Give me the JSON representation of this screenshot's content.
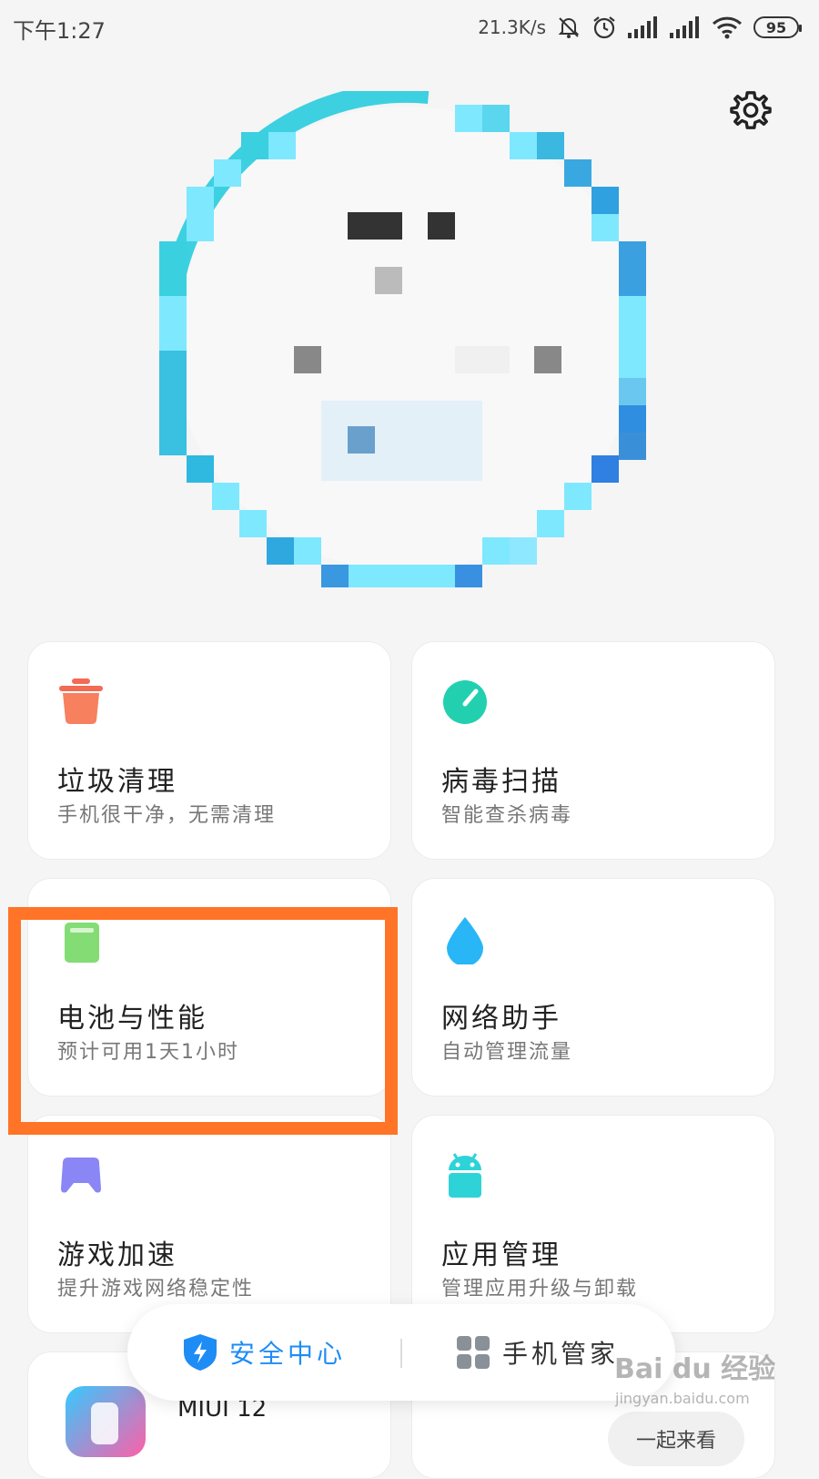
{
  "status_bar": {
    "time": "下午1:27",
    "net_speed": "21.3K/s",
    "battery": "95",
    "icons": [
      "mute-bell-icon",
      "alarm-icon",
      "signal-icon",
      "signal-icon",
      "wifi-icon",
      "battery-icon"
    ]
  },
  "header": {
    "settings_icon": "gear-icon"
  },
  "cards": [
    {
      "title": "垃圾清理",
      "subtitle": "手机很干净，无需清理",
      "icon": "trash-icon",
      "color": "#f36a55"
    },
    {
      "title": "病毒扫描",
      "subtitle": "智能查杀病毒",
      "icon": "scan-gauge-icon",
      "color": "#22d0b0"
    },
    {
      "title": "电池与性能",
      "subtitle": "预计可用1天1小时",
      "icon": "battery-card-icon",
      "color": "#7ed66e"
    },
    {
      "title": "网络助手",
      "subtitle": "自动管理流量",
      "icon": "droplet-icon",
      "color": "#29b6f6"
    },
    {
      "title": "游戏加速",
      "subtitle": "提升游戏网络稳定性",
      "icon": "gamepad-icon",
      "color": "#8b86f5"
    },
    {
      "title": "应用管理",
      "subtitle": "管理应用升级与卸载",
      "icon": "android-icon",
      "color": "#2ed3d8"
    }
  ],
  "miui": {
    "label": "MIUI 12",
    "peek_button": "一起来看"
  },
  "tab_bar": {
    "security": "安全中心",
    "manager": "手机管家"
  },
  "watermark": {
    "brand": "Bai du 经验",
    "url": "jingyan.baidu.com"
  },
  "colors": {
    "highlight": "#ff7426",
    "accent_blue": "#1e8cf5"
  }
}
